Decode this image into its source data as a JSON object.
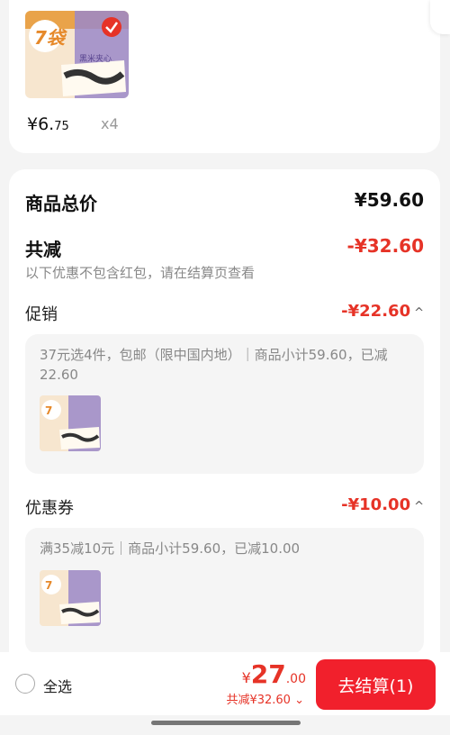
{
  "product": {
    "price_int": "¥6.",
    "price_dec": "75",
    "quantity": "x4",
    "badge_text": "7袋",
    "label_text": "黑米夹心"
  },
  "summary": {
    "total_label": "商品总价",
    "total_value": "¥59.60",
    "discount_label": "共减",
    "discount_value": "-¥32.60",
    "note": "以下优惠不包含红包，请在结算页查看"
  },
  "promotion": {
    "label": "促销",
    "value": "-¥22.60",
    "chevron": "^",
    "detail": "37元选4件，包邮（限中国内地）｜商品小计59.60，已减22.60"
  },
  "coupon": {
    "label": "优惠券",
    "value": "-¥10.00",
    "chevron": "^",
    "detail": "满35减10元｜商品小计59.60，已减10.00"
  },
  "bottom_bar": {
    "select_all": "全选",
    "currency": "¥",
    "total_int": "27",
    "total_dec": ".00",
    "discount_line": "共减¥32.60",
    "discount_chevron": "⌄",
    "checkout_label": "去结算(1)"
  },
  "colors": {
    "accent_red": "#e63327",
    "button_red": "#f1202c"
  },
  "icons": [
    "product-thumbnail",
    "check-badge-icon",
    "chevron-up-icon",
    "chevron-down-icon",
    "radio-circle-icon"
  ]
}
